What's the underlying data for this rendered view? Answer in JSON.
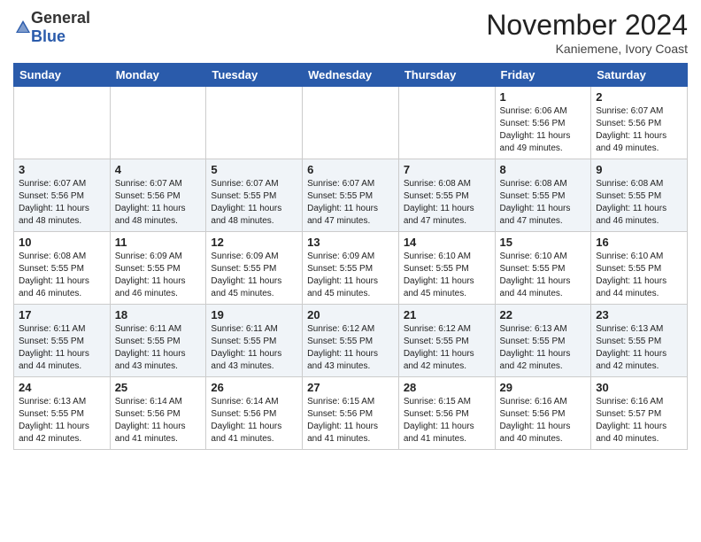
{
  "header": {
    "logo_general": "General",
    "logo_blue": "Blue",
    "month": "November 2024",
    "location": "Kaniemene, Ivory Coast"
  },
  "days_of_week": [
    "Sunday",
    "Monday",
    "Tuesday",
    "Wednesday",
    "Thursday",
    "Friday",
    "Saturday"
  ],
  "weeks": [
    [
      {
        "day": "",
        "info": ""
      },
      {
        "day": "",
        "info": ""
      },
      {
        "day": "",
        "info": ""
      },
      {
        "day": "",
        "info": ""
      },
      {
        "day": "",
        "info": ""
      },
      {
        "day": "1",
        "info": "Sunrise: 6:06 AM\nSunset: 5:56 PM\nDaylight: 11 hours and 49 minutes."
      },
      {
        "day": "2",
        "info": "Sunrise: 6:07 AM\nSunset: 5:56 PM\nDaylight: 11 hours and 49 minutes."
      }
    ],
    [
      {
        "day": "3",
        "info": "Sunrise: 6:07 AM\nSunset: 5:56 PM\nDaylight: 11 hours and 48 minutes."
      },
      {
        "day": "4",
        "info": "Sunrise: 6:07 AM\nSunset: 5:56 PM\nDaylight: 11 hours and 48 minutes."
      },
      {
        "day": "5",
        "info": "Sunrise: 6:07 AM\nSunset: 5:55 PM\nDaylight: 11 hours and 48 minutes."
      },
      {
        "day": "6",
        "info": "Sunrise: 6:07 AM\nSunset: 5:55 PM\nDaylight: 11 hours and 47 minutes."
      },
      {
        "day": "7",
        "info": "Sunrise: 6:08 AM\nSunset: 5:55 PM\nDaylight: 11 hours and 47 minutes."
      },
      {
        "day": "8",
        "info": "Sunrise: 6:08 AM\nSunset: 5:55 PM\nDaylight: 11 hours and 47 minutes."
      },
      {
        "day": "9",
        "info": "Sunrise: 6:08 AM\nSunset: 5:55 PM\nDaylight: 11 hours and 46 minutes."
      }
    ],
    [
      {
        "day": "10",
        "info": "Sunrise: 6:08 AM\nSunset: 5:55 PM\nDaylight: 11 hours and 46 minutes."
      },
      {
        "day": "11",
        "info": "Sunrise: 6:09 AM\nSunset: 5:55 PM\nDaylight: 11 hours and 46 minutes."
      },
      {
        "day": "12",
        "info": "Sunrise: 6:09 AM\nSunset: 5:55 PM\nDaylight: 11 hours and 45 minutes."
      },
      {
        "day": "13",
        "info": "Sunrise: 6:09 AM\nSunset: 5:55 PM\nDaylight: 11 hours and 45 minutes."
      },
      {
        "day": "14",
        "info": "Sunrise: 6:10 AM\nSunset: 5:55 PM\nDaylight: 11 hours and 45 minutes."
      },
      {
        "day": "15",
        "info": "Sunrise: 6:10 AM\nSunset: 5:55 PM\nDaylight: 11 hours and 44 minutes."
      },
      {
        "day": "16",
        "info": "Sunrise: 6:10 AM\nSunset: 5:55 PM\nDaylight: 11 hours and 44 minutes."
      }
    ],
    [
      {
        "day": "17",
        "info": "Sunrise: 6:11 AM\nSunset: 5:55 PM\nDaylight: 11 hours and 44 minutes."
      },
      {
        "day": "18",
        "info": "Sunrise: 6:11 AM\nSunset: 5:55 PM\nDaylight: 11 hours and 43 minutes."
      },
      {
        "day": "19",
        "info": "Sunrise: 6:11 AM\nSunset: 5:55 PM\nDaylight: 11 hours and 43 minutes."
      },
      {
        "day": "20",
        "info": "Sunrise: 6:12 AM\nSunset: 5:55 PM\nDaylight: 11 hours and 43 minutes."
      },
      {
        "day": "21",
        "info": "Sunrise: 6:12 AM\nSunset: 5:55 PM\nDaylight: 11 hours and 42 minutes."
      },
      {
        "day": "22",
        "info": "Sunrise: 6:13 AM\nSunset: 5:55 PM\nDaylight: 11 hours and 42 minutes."
      },
      {
        "day": "23",
        "info": "Sunrise: 6:13 AM\nSunset: 5:55 PM\nDaylight: 11 hours and 42 minutes."
      }
    ],
    [
      {
        "day": "24",
        "info": "Sunrise: 6:13 AM\nSunset: 5:55 PM\nDaylight: 11 hours and 42 minutes."
      },
      {
        "day": "25",
        "info": "Sunrise: 6:14 AM\nSunset: 5:56 PM\nDaylight: 11 hours and 41 minutes."
      },
      {
        "day": "26",
        "info": "Sunrise: 6:14 AM\nSunset: 5:56 PM\nDaylight: 11 hours and 41 minutes."
      },
      {
        "day": "27",
        "info": "Sunrise: 6:15 AM\nSunset: 5:56 PM\nDaylight: 11 hours and 41 minutes."
      },
      {
        "day": "28",
        "info": "Sunrise: 6:15 AM\nSunset: 5:56 PM\nDaylight: 11 hours and 41 minutes."
      },
      {
        "day": "29",
        "info": "Sunrise: 6:16 AM\nSunset: 5:56 PM\nDaylight: 11 hours and 40 minutes."
      },
      {
        "day": "30",
        "info": "Sunrise: 6:16 AM\nSunset: 5:57 PM\nDaylight: 11 hours and 40 minutes."
      }
    ]
  ]
}
